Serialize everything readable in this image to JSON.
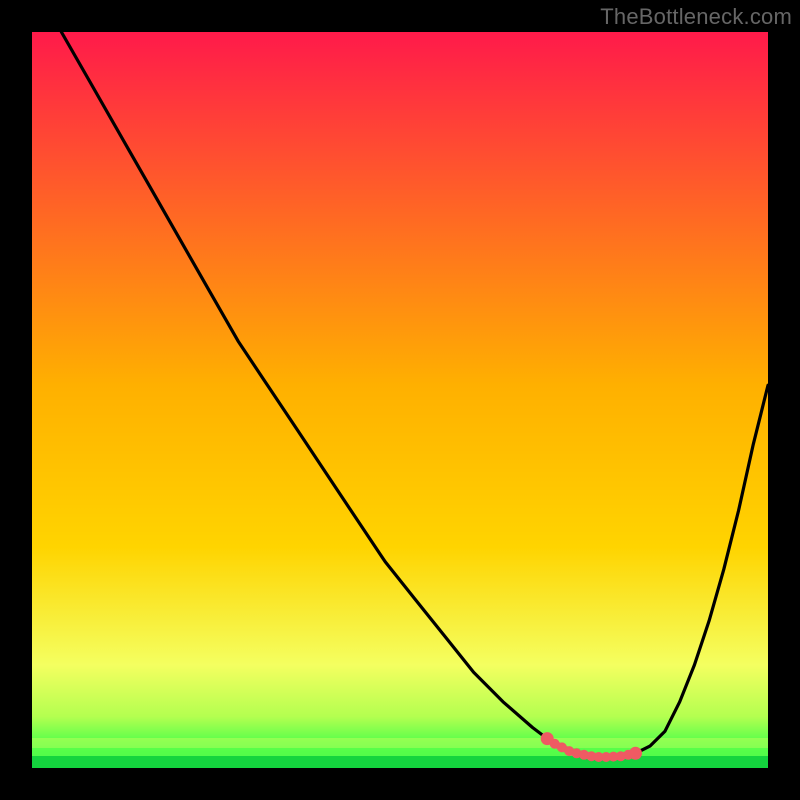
{
  "attribution": "TheBottleneck.com",
  "colors": {
    "top": "#ff1a4a",
    "mid": "#ffd400",
    "green_light": "#d8ff66",
    "green": "#18e24a",
    "curve": "#000000",
    "marker_stroke": "#ef5a63",
    "marker_fill": "#ef5a63",
    "page_bg": "#ffffff"
  },
  "chart_data": {
    "type": "line",
    "title": "",
    "xlabel": "",
    "ylabel": "",
    "xlim": [
      0,
      100
    ],
    "ylim": [
      0,
      100
    ],
    "legend": false,
    "grid": false,
    "series": [
      {
        "name": "curve",
        "x": [
          4,
          8,
          12,
          16,
          20,
          24,
          28,
          32,
          36,
          40,
          44,
          48,
          52,
          56,
          60,
          64,
          68,
          70,
          72,
          74,
          76,
          78,
          80,
          82,
          84,
          86,
          88,
          90,
          92,
          94,
          96,
          98,
          100
        ],
        "y": [
          100,
          93,
          86,
          79,
          72,
          65,
          58,
          52,
          46,
          40,
          34,
          28,
          23,
          18,
          13,
          9,
          5.5,
          4,
          2.8,
          2.0,
          1.6,
          1.5,
          1.6,
          2.0,
          3.0,
          5.0,
          9.0,
          14.0,
          20.0,
          27.0,
          35.0,
          44.0,
          52.0
        ]
      }
    ],
    "markers": {
      "name": "highlight",
      "x": [
        70,
        71,
        72,
        73,
        74,
        75,
        76,
        77,
        78,
        79,
        80,
        81,
        82
      ],
      "y": [
        4.0,
        3.3,
        2.8,
        2.3,
        2.0,
        1.8,
        1.6,
        1.5,
        1.5,
        1.55,
        1.6,
        1.8,
        2.0
      ]
    }
  }
}
